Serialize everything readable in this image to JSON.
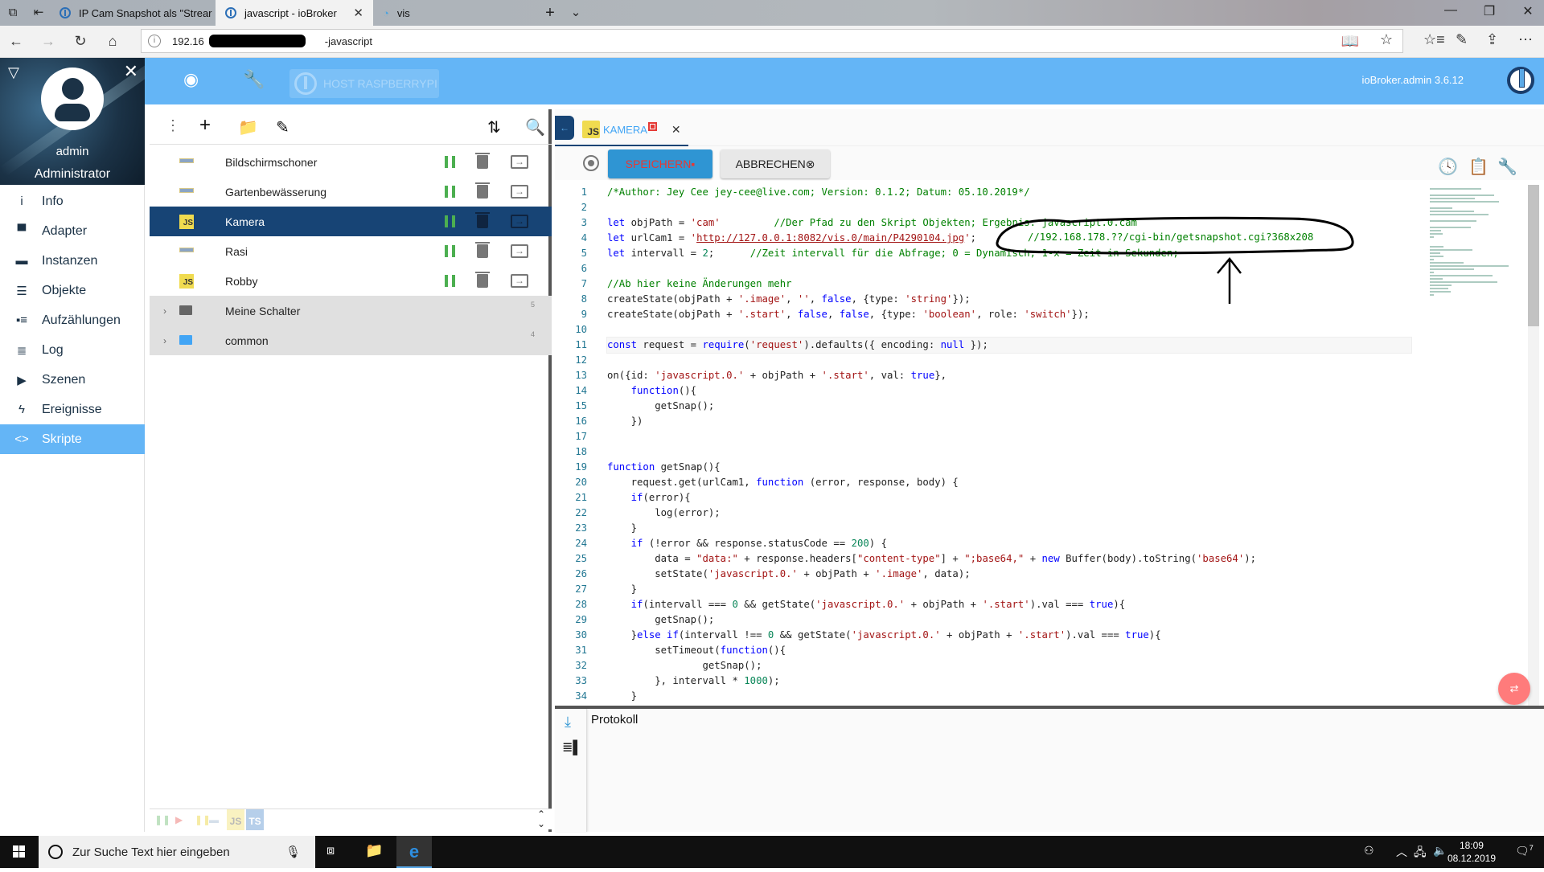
{
  "browser": {
    "tabs": [
      {
        "title": "IP Cam Snapshot als \"Strear",
        "active": false
      },
      {
        "title": "javascript - ioBroker",
        "active": true
      },
      {
        "title": "vis",
        "active": false
      }
    ],
    "url_prefix": "192.16",
    "url_suffix": "-javascript"
  },
  "header": {
    "host_label": "HOST RASPBERRYPI",
    "version": "ioBroker.admin 3.6.12"
  },
  "sidebar": {
    "user": "admin",
    "role": "Administrator",
    "items": [
      {
        "label": "Info",
        "icon": "info-icon",
        "glyph": "i"
      },
      {
        "label": "Adapter",
        "icon": "store-icon",
        "glyph": "▀"
      },
      {
        "label": "Instanzen",
        "icon": "instances-icon",
        "glyph": "▬"
      },
      {
        "label": "Objekte",
        "icon": "list-icon",
        "glyph": "☰"
      },
      {
        "label": "Aufzählungen",
        "icon": "enums-icon",
        "glyph": "▪≡"
      },
      {
        "label": "Log",
        "icon": "log-icon",
        "glyph": "≣"
      },
      {
        "label": "Szenen",
        "icon": "scenes-icon",
        "glyph": "▶"
      },
      {
        "label": "Ereignisse",
        "icon": "flash-icon",
        "glyph": "ϟ"
      },
      {
        "label": "Skripte",
        "icon": "code-icon",
        "glyph": "<>",
        "active": true
      }
    ]
  },
  "scripts": {
    "items": [
      {
        "name": "Bildschirmschoner",
        "type": "blockly"
      },
      {
        "name": "Gartenbewässerung",
        "type": "blockly"
      },
      {
        "name": "Kamera",
        "type": "js",
        "selected": true
      },
      {
        "name": "Rasi",
        "type": "blockly"
      },
      {
        "name": "Robby",
        "type": "js"
      }
    ],
    "folders": [
      {
        "name": "Meine Schalter",
        "count": "5",
        "color": "#666666"
      },
      {
        "name": "common",
        "count": "4",
        "color": "#42a5f5"
      }
    ],
    "type_badge_js": "JS",
    "type_badge_ts": "TS"
  },
  "editor": {
    "tab_label": "KAMERA",
    "save_label": "SPEICHERN",
    "cancel_label": "ABBRECHEN",
    "log_title": "Protokoll",
    "lines": [
      [
        [
          "cm",
          "/*Author: Jey Cee jey-cee@live.com; Version: 0.1.2; Datum: 05.10.2019*/"
        ]
      ],
      [],
      [
        [
          "kw",
          "let"
        ],
        [
          "pl",
          " objPath = "
        ],
        [
          "st",
          "'cam'"
        ],
        [
          "pl",
          "         "
        ],
        [
          "cm",
          "//Der Pfad zu den Skript Objekten; Ergebnis: javascript.0.cam"
        ]
      ],
      [
        [
          "kw",
          "let"
        ],
        [
          "pl",
          " urlCam1 = "
        ],
        [
          "st",
          "'"
        ],
        [
          "lk",
          "http://127.0.0.1:8082/vis.0/main/P4290104.jpg"
        ],
        [
          "st",
          "'"
        ],
        [
          "pl",
          ";"
        ]
      ],
      [
        [
          "kw",
          "let"
        ],
        [
          "pl",
          " intervall = "
        ],
        [
          "nu",
          "2"
        ],
        [
          "pl",
          ";      "
        ],
        [
          "cm",
          "//Zeit intervall für die Abfrage; 0 = Dynamisch, 1-x = Zeit in Sekunden;"
        ]
      ],
      [],
      [
        [
          "cm",
          "//Ab hier keine Änderungen mehr"
        ]
      ],
      [
        [
          "pl",
          "createState(objPath + "
        ],
        [
          "st",
          "'.image'"
        ],
        [
          "pl",
          ", "
        ],
        [
          "st",
          "''"
        ],
        [
          "pl",
          ", "
        ],
        [
          "kw",
          "false"
        ],
        [
          "pl",
          ", {type: "
        ],
        [
          "st",
          "'string'"
        ],
        [
          "pl",
          "});"
        ]
      ],
      [
        [
          "pl",
          "createState(objPath + "
        ],
        [
          "st",
          "'.start'"
        ],
        [
          "pl",
          ", "
        ],
        [
          "kw",
          "false"
        ],
        [
          "pl",
          ", "
        ],
        [
          "kw",
          "false"
        ],
        [
          "pl",
          ", {type: "
        ],
        [
          "st",
          "'boolean'"
        ],
        [
          "pl",
          ", role: "
        ],
        [
          "st",
          "'switch'"
        ],
        [
          "pl",
          "});"
        ]
      ],
      [],
      [
        [
          "kw",
          "const"
        ],
        [
          "pl",
          " request = "
        ],
        [
          "kw",
          "require"
        ],
        [
          "pl",
          "("
        ],
        [
          "st",
          "'request'"
        ],
        [
          "pl",
          ").defaults({ encoding: "
        ],
        [
          "kw",
          "null"
        ],
        [
          "pl",
          " });"
        ]
      ],
      [],
      [
        [
          "pl",
          "on({id: "
        ],
        [
          "st",
          "'javascript.0.'"
        ],
        [
          "pl",
          " + objPath + "
        ],
        [
          "st",
          "'.start'"
        ],
        [
          "pl",
          ", val: "
        ],
        [
          "kw",
          "true"
        ],
        [
          "pl",
          "},"
        ]
      ],
      [
        [
          "pl",
          "    "
        ],
        [
          "kw",
          "function"
        ],
        [
          "pl",
          "(){"
        ]
      ],
      [
        [
          "pl",
          "        getSnap();"
        ]
      ],
      [
        [
          "pl",
          "    })"
        ]
      ],
      [],
      [],
      [
        [
          "kw",
          "function"
        ],
        [
          "pl",
          " getSnap(){"
        ]
      ],
      [
        [
          "pl",
          "    request.get(urlCam1, "
        ],
        [
          "kw",
          "function"
        ],
        [
          "pl",
          " (error, response, body) {"
        ]
      ],
      [
        [
          "pl",
          "    "
        ],
        [
          "kw",
          "if"
        ],
        [
          "pl",
          "(error){"
        ]
      ],
      [
        [
          "pl",
          "        log(error);"
        ]
      ],
      [
        [
          "pl",
          "    }"
        ]
      ],
      [
        [
          "pl",
          "    "
        ],
        [
          "kw",
          "if"
        ],
        [
          "pl",
          " (!error && response.statusCode == "
        ],
        [
          "nu",
          "200"
        ],
        [
          "pl",
          ") {"
        ]
      ],
      [
        [
          "pl",
          "        data = "
        ],
        [
          "st",
          "\"data:\""
        ],
        [
          "pl",
          " + response.headers["
        ],
        [
          "st",
          "\"content-type\""
        ],
        [
          "pl",
          "] + "
        ],
        [
          "st",
          "\";base64,\""
        ],
        [
          "pl",
          " + "
        ],
        [
          "kw",
          "new"
        ],
        [
          "pl",
          " Buffer(body).toString("
        ],
        [
          "st",
          "'base64'"
        ],
        [
          "pl",
          ");"
        ]
      ],
      [
        [
          "pl",
          "        setState("
        ],
        [
          "st",
          "'javascript.0.'"
        ],
        [
          "pl",
          " + objPath + "
        ],
        [
          "st",
          "'.image'"
        ],
        [
          "pl",
          ", data);"
        ]
      ],
      [
        [
          "pl",
          "    }"
        ]
      ],
      [
        [
          "pl",
          "    "
        ],
        [
          "kw",
          "if"
        ],
        [
          "pl",
          "(intervall === "
        ],
        [
          "nu",
          "0"
        ],
        [
          "pl",
          " && getState("
        ],
        [
          "st",
          "'javascript.0.'"
        ],
        [
          "pl",
          " + objPath + "
        ],
        [
          "st",
          "'.start'"
        ],
        [
          "pl",
          ").val === "
        ],
        [
          "kw",
          "true"
        ],
        [
          "pl",
          "){"
        ]
      ],
      [
        [
          "pl",
          "        getSnap();"
        ]
      ],
      [
        [
          "pl",
          "    }"
        ],
        [
          "kw",
          "else if"
        ],
        [
          "pl",
          "(intervall !== "
        ],
        [
          "nu",
          "0"
        ],
        [
          "pl",
          " && getState("
        ],
        [
          "st",
          "'javascript.0.'"
        ],
        [
          "pl",
          " + objPath + "
        ],
        [
          "st",
          "'.start'"
        ],
        [
          "pl",
          ").val === "
        ],
        [
          "kw",
          "true"
        ],
        [
          "pl",
          "){"
        ]
      ],
      [
        [
          "pl",
          "        setTimeout("
        ],
        [
          "kw",
          "function"
        ],
        [
          "pl",
          "(){"
        ]
      ],
      [
        [
          "pl",
          "                getSnap();"
        ]
      ],
      [
        [
          "pl",
          "        }, intervall * "
        ],
        [
          "nu",
          "1000"
        ],
        [
          "pl",
          ");"
        ]
      ],
      [
        [
          "pl",
          "    }"
        ]
      ]
    ],
    "cursor_line": 11,
    "annotation_text": "//192.168.178.??/cgi-bin/getsnapshot.cgi?368x208"
  },
  "taskbar": {
    "search_placeholder": "Zur Suche Text hier eingeben",
    "time": "18:09",
    "date": "08.12.2019",
    "notifications": "7"
  }
}
